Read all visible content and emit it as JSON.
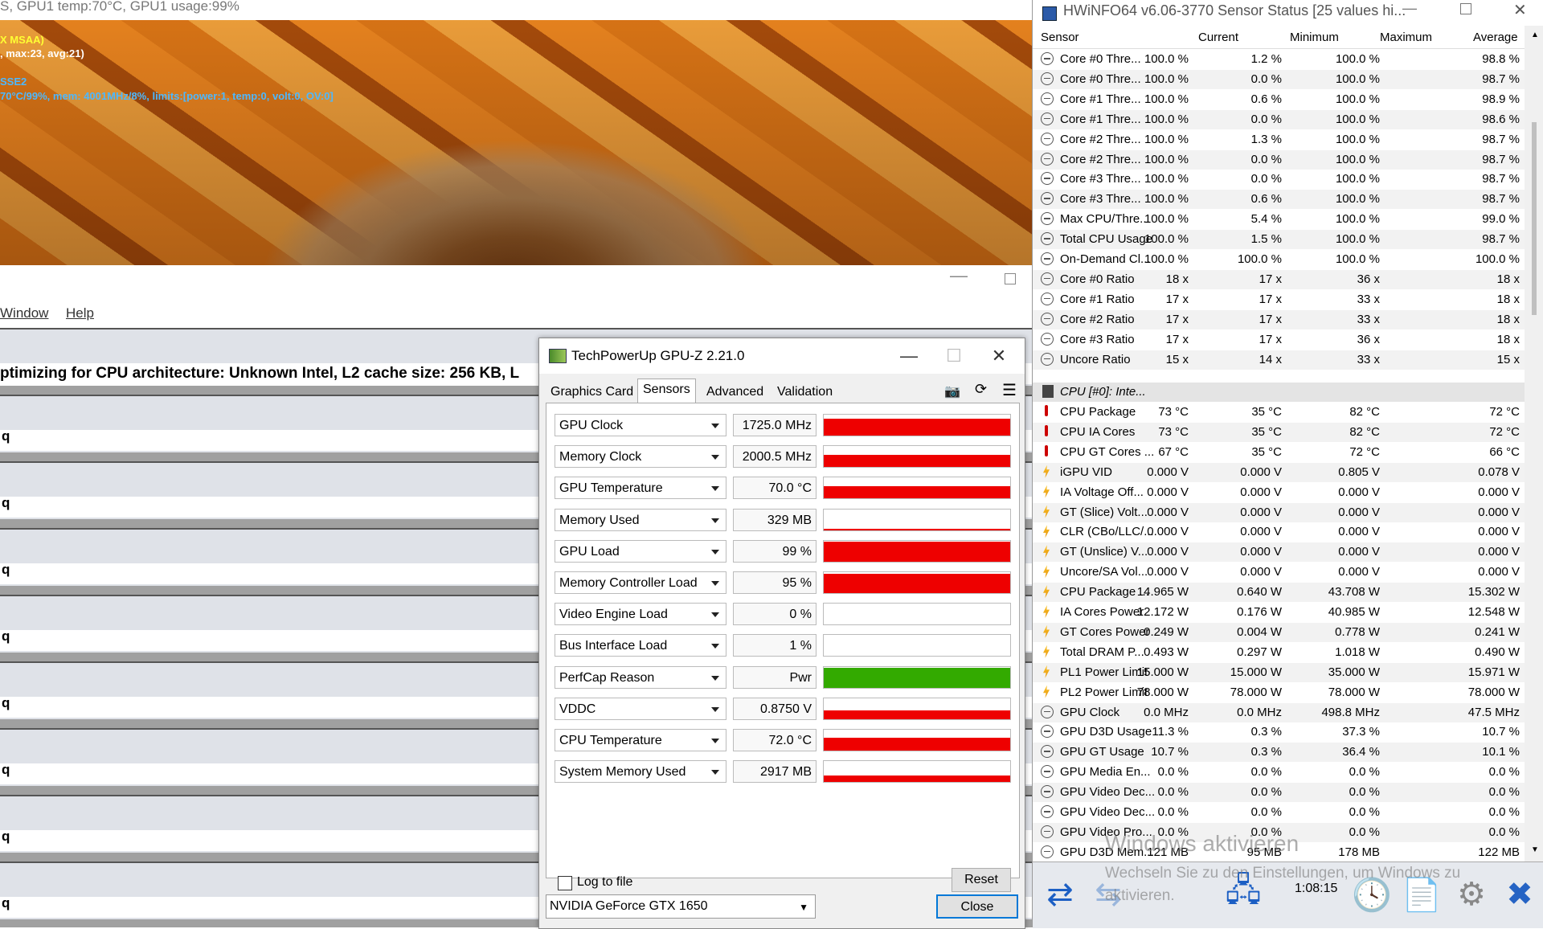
{
  "bg_window": {
    "title": "S, GPU1 temp:70°C, GPU1 usage:99%",
    "overlay_1": "X MSAA)",
    "overlay_2": ", max:23, avg:21)",
    "overlay_3": "SSE2",
    "overlay_4": "70°C/99%, mem: 4001MHz/8%, limits:[power:1, temp:0, volt:0, OV:0]",
    "menu": [
      "Window",
      "Help"
    ],
    "optimizing_line": "ptimizing for CPU architecture: Unknown Intel, L2 cache size: 256 KB, L",
    "row_marker": "q",
    "colors": {
      "overlay_yellow": "#ffff33",
      "overlay_white": "#ffffff",
      "overlay_blue": "#4db8ff"
    }
  },
  "gpuz": {
    "title": "TechPowerUp GPU-Z 2.21.0",
    "tabs": [
      "Graphics Card",
      "Sensors",
      "Advanced",
      "Validation"
    ],
    "active_tab": "Sensors",
    "sensors": [
      {
        "label": "GPU Clock",
        "value": "1725.0 MHz",
        "level": 0.8,
        "color": "#ee0000"
      },
      {
        "label": "Memory Clock",
        "value": "2000.5 MHz",
        "level": 0.6,
        "color": "#ee0000"
      },
      {
        "label": "GPU Temperature",
        "value": "70.0 °C",
        "level": 0.6,
        "color": "#ee0000"
      },
      {
        "label": "Memory Used",
        "value": "329 MB",
        "level": 0.08,
        "color": "#ee0000"
      },
      {
        "label": "GPU Load",
        "value": "99 %",
        "level": 0.95,
        "color": "#ee0000"
      },
      {
        "label": "Memory Controller Load",
        "value": "95 %",
        "level": 0.92,
        "color": "#ee0000"
      },
      {
        "label": "Video Engine Load",
        "value": "0 %",
        "level": 0,
        "color": "#ee0000"
      },
      {
        "label": "Bus Interface Load",
        "value": "1 %",
        "level": 0,
        "color": "#ee0000"
      },
      {
        "label": "PerfCap Reason",
        "value": "Pwr",
        "level": 0.95,
        "color": "#33aa00"
      },
      {
        "label": "VDDC",
        "value": "0.8750 V",
        "level": 0.4,
        "color": "#ee0000"
      },
      {
        "label": "CPU Temperature",
        "value": "72.0 °C",
        "level": 0.6,
        "color": "#ee0000"
      },
      {
        "label": "System Memory Used",
        "value": "2917 MB",
        "level": 0.3,
        "color": "#ee0000"
      }
    ],
    "log_label": "Log to file",
    "reset_label": "Reset",
    "device": "NVIDIA GeForce GTX 1650",
    "close_label": "Close",
    "icons": [
      "camera-icon",
      "refresh-icon",
      "menu-icon"
    ]
  },
  "hwinfo": {
    "title": "HWiNFO64 v6.06-3770 Sensor Status [25 values hi...",
    "columns": [
      "Sensor",
      "Current",
      "Minimum",
      "Maximum",
      "Average"
    ],
    "rows": [
      {
        "icon": "clock",
        "name": "Core #0 Thre...",
        "cur": "100.0 %",
        "min": "1.2 %",
        "max": "100.0 %",
        "avg": "98.8 %"
      },
      {
        "icon": "clock",
        "name": "Core #0 Thre...",
        "cur": "100.0 %",
        "min": "0.0 %",
        "max": "100.0 %",
        "avg": "98.7 %"
      },
      {
        "icon": "clock",
        "name": "Core #1 Thre...",
        "cur": "100.0 %",
        "min": "0.6 %",
        "max": "100.0 %",
        "avg": "98.9 %"
      },
      {
        "icon": "clock",
        "name": "Core #1 Thre...",
        "cur": "100.0 %",
        "min": "0.0 %",
        "max": "100.0 %",
        "avg": "98.6 %"
      },
      {
        "icon": "clock",
        "name": "Core #2 Thre...",
        "cur": "100.0 %",
        "min": "1.3 %",
        "max": "100.0 %",
        "avg": "98.7 %"
      },
      {
        "icon": "clock",
        "name": "Core #2 Thre...",
        "cur": "100.0 %",
        "min": "0.0 %",
        "max": "100.0 %",
        "avg": "98.7 %"
      },
      {
        "icon": "clock",
        "name": "Core #3 Thre...",
        "cur": "100.0 %",
        "min": "0.0 %",
        "max": "100.0 %",
        "avg": "98.7 %"
      },
      {
        "icon": "clock",
        "name": "Core #3 Thre...",
        "cur": "100.0 %",
        "min": "0.6 %",
        "max": "100.0 %",
        "avg": "98.7 %"
      },
      {
        "icon": "clock",
        "name": "Max CPU/Thre...",
        "cur": "100.0 %",
        "min": "5.4 %",
        "max": "100.0 %",
        "avg": "99.0 %"
      },
      {
        "icon": "clock",
        "name": "Total CPU Usage",
        "cur": "100.0 %",
        "min": "1.5 %",
        "max": "100.0 %",
        "avg": "98.7 %"
      },
      {
        "icon": "clock",
        "name": "On-Demand Cl...",
        "cur": "100.0 %",
        "min": "100.0 %",
        "max": "100.0 %",
        "avg": "100.0 %"
      },
      {
        "icon": "clock",
        "name": "Core #0 Ratio",
        "cur": "18 x",
        "min": "17 x",
        "max": "36 x",
        "avg": "18 x"
      },
      {
        "icon": "clock",
        "name": "Core #1 Ratio",
        "cur": "17 x",
        "min": "17 x",
        "max": "33 x",
        "avg": "18 x"
      },
      {
        "icon": "clock",
        "name": "Core #2 Ratio",
        "cur": "17 x",
        "min": "17 x",
        "max": "33 x",
        "avg": "18 x"
      },
      {
        "icon": "clock",
        "name": "Core #3 Ratio",
        "cur": "17 x",
        "min": "17 x",
        "max": "36 x",
        "avg": "18 x"
      },
      {
        "icon": "clock",
        "name": "Uncore Ratio",
        "cur": "15 x",
        "min": "14 x",
        "max": "33 x",
        "avg": "15 x"
      }
    ],
    "group_label": "CPU [#0]: Inte...",
    "rows2": [
      {
        "icon": "therm",
        "name": "CPU Package",
        "cur": "73 °C",
        "min": "35 °C",
        "max": "82 °C",
        "avg": "72 °C"
      },
      {
        "icon": "therm",
        "name": "CPU IA Cores",
        "cur": "73 °C",
        "min": "35 °C",
        "max": "82 °C",
        "avg": "72 °C"
      },
      {
        "icon": "therm",
        "name": "CPU GT Cores ...",
        "cur": "67 °C",
        "min": "35 °C",
        "max": "72 °C",
        "avg": "66 °C"
      },
      {
        "icon": "bolt",
        "name": "iGPU VID",
        "cur": "0.000 V",
        "min": "0.000 V",
        "max": "0.805 V",
        "avg": "0.078 V"
      },
      {
        "icon": "bolt",
        "name": "IA Voltage Off...",
        "cur": "0.000 V",
        "min": "0.000 V",
        "max": "0.000 V",
        "avg": "0.000 V"
      },
      {
        "icon": "bolt",
        "name": "GT (Slice) Volt...",
        "cur": "0.000 V",
        "min": "0.000 V",
        "max": "0.000 V",
        "avg": "0.000 V"
      },
      {
        "icon": "bolt",
        "name": "CLR (CBo/LLC/...",
        "cur": "0.000 V",
        "min": "0.000 V",
        "max": "0.000 V",
        "avg": "0.000 V"
      },
      {
        "icon": "bolt",
        "name": "GT (Unslice) V...",
        "cur": "0.000 V",
        "min": "0.000 V",
        "max": "0.000 V",
        "avg": "0.000 V"
      },
      {
        "icon": "bolt",
        "name": "Uncore/SA Vol...",
        "cur": "0.000 V",
        "min": "0.000 V",
        "max": "0.000 V",
        "avg": "0.000 V"
      },
      {
        "icon": "bolt",
        "name": "CPU Package ...",
        "cur": "14.965 W",
        "min": "0.640 W",
        "max": "43.708 W",
        "avg": "15.302 W"
      },
      {
        "icon": "bolt",
        "name": "IA Cores Power",
        "cur": "12.172 W",
        "min": "0.176 W",
        "max": "40.985 W",
        "avg": "12.548 W"
      },
      {
        "icon": "bolt",
        "name": "GT Cores Power",
        "cur": "0.249 W",
        "min": "0.004 W",
        "max": "0.778 W",
        "avg": "0.241 W"
      },
      {
        "icon": "bolt",
        "name": "Total DRAM P...",
        "cur": "0.493 W",
        "min": "0.297 W",
        "max": "1.018 W",
        "avg": "0.490 W"
      },
      {
        "icon": "bolt",
        "name": "PL1 Power Limit",
        "cur": "15.000 W",
        "min": "15.000 W",
        "max": "35.000 W",
        "avg": "15.971 W"
      },
      {
        "icon": "bolt",
        "name": "PL2 Power Limit",
        "cur": "78.000 W",
        "min": "78.000 W",
        "max": "78.000 W",
        "avg": "78.000 W"
      },
      {
        "icon": "clock",
        "name": "GPU Clock",
        "cur": "0.0 MHz",
        "min": "0.0 MHz",
        "max": "498.8 MHz",
        "avg": "47.5 MHz"
      },
      {
        "icon": "clock",
        "name": "GPU D3D Usage",
        "cur": "11.3 %",
        "min": "0.3 %",
        "max": "37.3 %",
        "avg": "10.7 %"
      },
      {
        "icon": "clock",
        "name": "GPU GT Usage",
        "cur": "10.7 %",
        "min": "0.3 %",
        "max": "36.4 %",
        "avg": "10.1 %"
      },
      {
        "icon": "clock",
        "name": "GPU Media En...",
        "cur": "0.0 %",
        "min": "0.0 %",
        "max": "0.0 %",
        "avg": "0.0 %"
      },
      {
        "icon": "clock",
        "name": "GPU Video Dec...",
        "cur": "0.0 %",
        "min": "0.0 %",
        "max": "0.0 %",
        "avg": "0.0 %"
      },
      {
        "icon": "clock",
        "name": "GPU Video Dec...",
        "cur": "0.0 %",
        "min": "0.0 %",
        "max": "0.0 %",
        "avg": "0.0 %"
      },
      {
        "icon": "clock",
        "name": "GPU Video Pro...",
        "cur": "0.0 %",
        "min": "0.0 %",
        "max": "0.0 %",
        "avg": "0.0 %"
      },
      {
        "icon": "clock",
        "name": "GPU D3D Mem...",
        "cur": "121 MB",
        "min": "95 MB",
        "max": "178 MB",
        "avg": "122 MB"
      }
    ],
    "elapsed": "1:08:15",
    "watermark_1": "Windows aktivieren",
    "watermark_2": "Wechseln Sie zu den Einstellungen, um Windows zu",
    "watermark_3": "aktivieren."
  }
}
